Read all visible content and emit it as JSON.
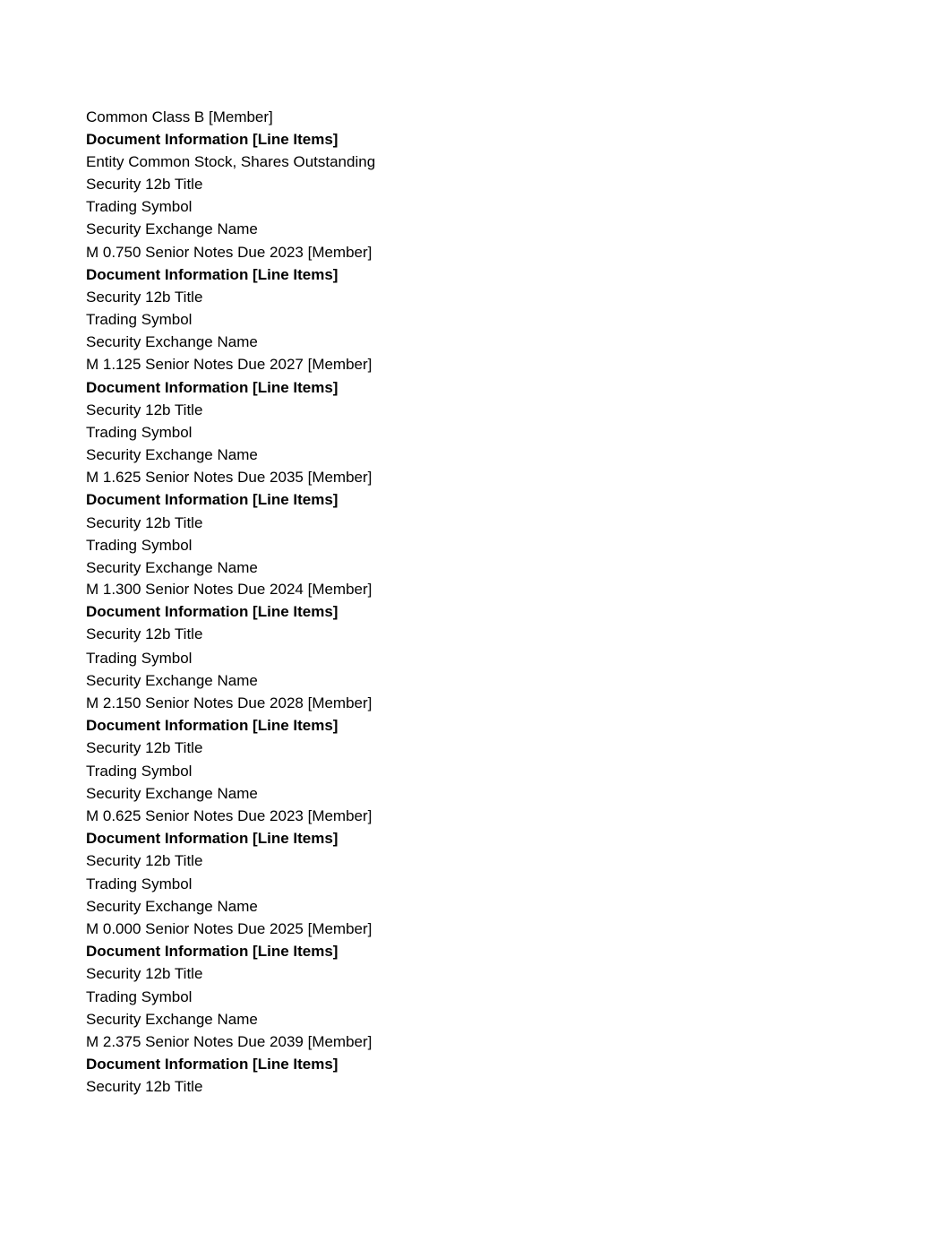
{
  "rows": [
    {
      "text": "Common Class B [Member]",
      "bold": false
    },
    {
      "text": "Document Information [Line Items]",
      "bold": true
    },
    {
      "text": "Entity Common Stock, Shares Outstanding",
      "bold": false
    },
    {
      "text": "Security 12b Title",
      "bold": false
    },
    {
      "text": "Trading Symbol",
      "bold": false
    },
    {
      "text": "Security Exchange Name",
      "bold": false
    },
    {
      "text": "M 0.750 Senior Notes Due 2023 [Member]",
      "bold": false
    },
    {
      "text": "Document Information [Line Items]",
      "bold": true
    },
    {
      "text": "Security 12b Title",
      "bold": false
    },
    {
      "text": "Trading Symbol",
      "bold": false
    },
    {
      "text": "Security Exchange Name",
      "bold": false
    },
    {
      "text": "M 1.125 Senior Notes Due 2027 [Member]",
      "bold": false
    },
    {
      "text": "Document Information [Line Items]",
      "bold": true
    },
    {
      "text": "Security 12b Title",
      "bold": false
    },
    {
      "text": "Trading Symbol",
      "bold": false
    },
    {
      "text": "Security Exchange Name",
      "bold": false
    },
    {
      "text": "M 1.625 Senior Notes Due 2035 [Member]",
      "bold": false
    },
    {
      "text": "Document Information [Line Items]",
      "bold": true
    },
    {
      "text": "Security 12b Title",
      "bold": false
    },
    {
      "text": "Trading Symbol",
      "bold": false
    },
    {
      "text": "Security Exchange Name",
      "bold": false
    },
    {
      "text": "M 1.300 Senior Notes Due 2024 [Member]",
      "bold": false
    },
    {
      "text": "Document Information [Line Items]",
      "bold": true
    },
    {
      "text": "Security 12b Title",
      "bold": false
    },
    {
      "text": "Trading Symbol",
      "bold": false
    },
    {
      "text": "Security Exchange Name",
      "bold": false
    },
    {
      "text": "M 2.150 Senior Notes Due 2028 [Member]",
      "bold": false
    },
    {
      "text": "Document Information [Line Items]",
      "bold": true
    },
    {
      "text": "Security 12b Title",
      "bold": false
    },
    {
      "text": "Trading Symbol",
      "bold": false
    },
    {
      "text": "Security Exchange Name",
      "bold": false
    },
    {
      "text": "M 0.625 Senior Notes Due 2023 [Member]",
      "bold": false
    },
    {
      "text": "Document Information [Line Items]",
      "bold": true
    },
    {
      "text": "Security 12b Title",
      "bold": false
    },
    {
      "text": "Trading Symbol",
      "bold": false
    },
    {
      "text": "Security Exchange Name",
      "bold": false
    },
    {
      "text": "M 0.000 Senior Notes Due 2025 [Member]",
      "bold": false
    },
    {
      "text": "Document Information [Line Items]",
      "bold": true
    },
    {
      "text": "Security 12b Title",
      "bold": false
    },
    {
      "text": "Trading Symbol",
      "bold": false
    },
    {
      "text": "Security Exchange Name",
      "bold": false
    },
    {
      "text": "M 2.375 Senior Notes Due 2039 [Member]",
      "bold": false
    },
    {
      "text": "Document Information [Line Items]",
      "bold": true
    },
    {
      "text": "Security 12b Title",
      "bold": false
    }
  ]
}
